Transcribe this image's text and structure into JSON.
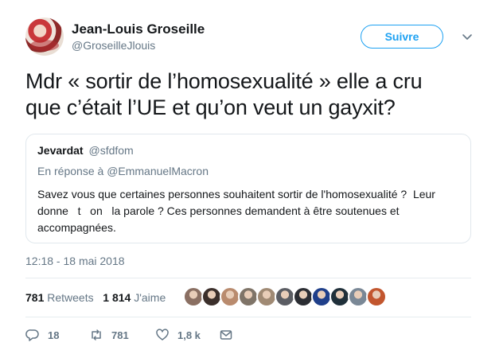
{
  "author": {
    "name": "Jean-Louis Groseille",
    "handle": "@GroseilleJlouis"
  },
  "follow_button": "Suivre",
  "tweet": {
    "line1": "Mdr « sortir de l’homosexualité » elle a cru",
    "line2": "que c’était l’UE et qu’on veut un gayxit?"
  },
  "quoted": {
    "name": "Jevardat",
    "handle": "@sfdfom",
    "reply_prefix": "En réponse à",
    "reply_to": "@EmmanuelMacron",
    "body_line1": "Savez vous que certaines personnes souhaitent sortir de l'homosexualité ?  Leur",
    "body_line2": "donne   t   on   la parole ? Ces personnes demandent à être soutenues et",
    "body_line3": "accompagnées."
  },
  "timestamp": "12:18 - 18 mai 2018",
  "stats": {
    "retweets_count": "781",
    "retweets_label": "Retweets",
    "likes_count": "1 814",
    "likes_label": "J'aime"
  },
  "likers": [
    {
      "color": "#8a6f62"
    },
    {
      "color": "#3b2f2b"
    },
    {
      "color": "#b98b6e"
    },
    {
      "color": "#7f7468"
    },
    {
      "color": "#a08a74"
    },
    {
      "color": "#5b5d63"
    },
    {
      "color": "#2b2d33"
    },
    {
      "color": "#1f3f8a"
    },
    {
      "color": "#20303a"
    },
    {
      "color": "#7a8896"
    },
    {
      "color": "#c2562e"
    }
  ],
  "actions": {
    "replies": "18",
    "retweets": "781",
    "likes": "1,8 k"
  },
  "colors": {
    "accent": "#1da1f2",
    "muted": "#657786",
    "text": "#14171a"
  }
}
